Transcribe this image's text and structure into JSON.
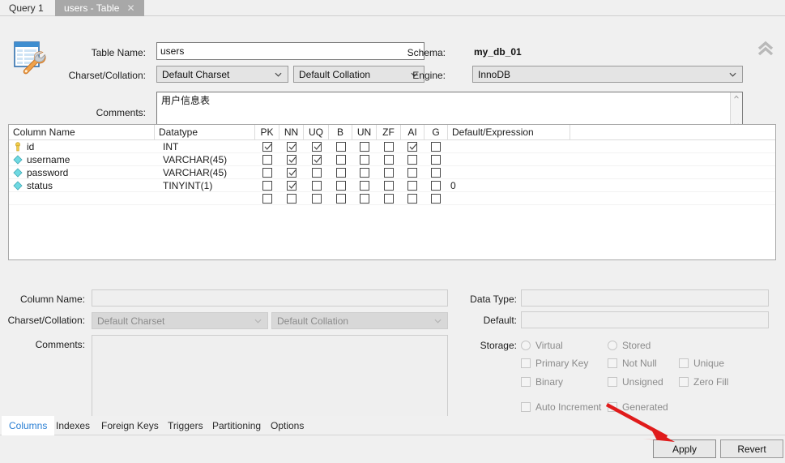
{
  "window": {
    "tabs": [
      {
        "label": "Query 1",
        "active": false,
        "closable": false
      },
      {
        "label": "users - Table",
        "active": true,
        "closable": true
      }
    ],
    "close_glyph": "✕"
  },
  "table_header": {
    "icon": "table-editor-icon",
    "table_name_label": "Table Name:",
    "table_name_value": "users",
    "charset_collation_label": "Charset/Collation:",
    "charset_value": "Default Charset",
    "collation_value": "Default Collation",
    "comments_label": "Comments:",
    "comments_value": "用户信息表",
    "schema_label": "Schema:",
    "schema_value": "my_db_01",
    "engine_label": "Engine:",
    "engine_value": "InnoDB",
    "collapse_tooltip": "collapse-icon"
  },
  "grid": {
    "headers": [
      "Column Name",
      "Datatype",
      "PK",
      "NN",
      "UQ",
      "B",
      "UN",
      "ZF",
      "AI",
      "G",
      "Default/Expression"
    ],
    "rows": [
      {
        "icon": "primary-key-icon",
        "name": "id",
        "datatype": "INT",
        "pk": true,
        "nn": true,
        "uq": true,
        "b": false,
        "un": false,
        "zf": false,
        "ai": true,
        "g": false,
        "default": ""
      },
      {
        "icon": "column-icon",
        "name": "username",
        "datatype": "VARCHAR(45)",
        "pk": false,
        "nn": true,
        "uq": true,
        "b": false,
        "un": false,
        "zf": false,
        "ai": false,
        "g": false,
        "default": ""
      },
      {
        "icon": "column-icon",
        "name": "password",
        "datatype": "VARCHAR(45)",
        "pk": false,
        "nn": true,
        "uq": false,
        "b": false,
        "un": false,
        "zf": false,
        "ai": false,
        "g": false,
        "default": ""
      },
      {
        "icon": "column-icon",
        "name": "status",
        "datatype": "TINYINT(1)",
        "pk": false,
        "nn": true,
        "uq": false,
        "b": false,
        "un": false,
        "zf": false,
        "ai": false,
        "g": false,
        "default": "0"
      },
      {
        "icon": "",
        "name": "",
        "datatype": "",
        "pk": false,
        "nn": false,
        "uq": false,
        "b": false,
        "un": false,
        "zf": false,
        "ai": false,
        "g": false,
        "default": ""
      }
    ]
  },
  "detail": {
    "column_name_label": "Column Name:",
    "column_name_value": "",
    "charset_collation_label": "Charset/Collation:",
    "charset_value": "Default Charset",
    "collation_value": "Default Collation",
    "comments_label": "Comments:",
    "comments_value": "",
    "data_type_label": "Data Type:",
    "data_type_value": "",
    "default_label": "Default:",
    "default_value": "",
    "storage_label": "Storage:",
    "storage_options": [
      {
        "label": "Virtual",
        "type": "radio",
        "checked": false
      },
      {
        "label": "Stored",
        "type": "radio",
        "checked": false
      },
      {
        "label": "Primary Key",
        "type": "checkbox",
        "checked": false
      },
      {
        "label": "Not Null",
        "type": "checkbox",
        "checked": false
      },
      {
        "label": "Unique",
        "type": "checkbox",
        "checked": false
      },
      {
        "label": "Binary",
        "type": "checkbox",
        "checked": false
      },
      {
        "label": "Unsigned",
        "type": "checkbox",
        "checked": false
      },
      {
        "label": "Zero Fill",
        "type": "checkbox",
        "checked": false
      },
      {
        "label": "Auto Increment",
        "type": "checkbox",
        "checked": false
      },
      {
        "label": "Generated",
        "type": "checkbox",
        "checked": false
      }
    ]
  },
  "bottom_tabs": [
    {
      "label": "Columns",
      "active": true
    },
    {
      "label": "Indexes",
      "active": false
    },
    {
      "label": "Foreign Keys",
      "active": false
    },
    {
      "label": "Triggers",
      "active": false
    },
    {
      "label": "Partitioning",
      "active": false
    },
    {
      "label": "Options",
      "active": false
    }
  ],
  "footer": {
    "apply_label": "Apply",
    "revert_label": "Revert"
  },
  "annotation": {
    "arrow_color": "#e01b1b",
    "points_to": "Apply"
  },
  "colors": {
    "active_tab_bg": "#a8a8a8",
    "accent_tab_text": "#2a7fd4",
    "window_bg": "#f0f0f0",
    "grid_bg": "#ffffff",
    "key_icon": "#f2cc4a",
    "column_icon": "#6fd9e2"
  }
}
